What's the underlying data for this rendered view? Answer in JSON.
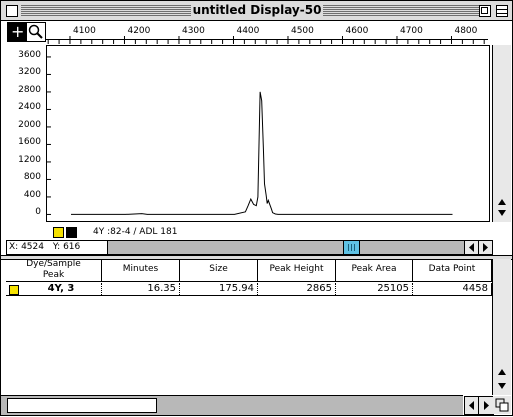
{
  "window": {
    "title": "untitled Display-50"
  },
  "ruler": {
    "ticks": [
      "4100",
      "4200",
      "4300",
      "4400",
      "4500",
      "4600",
      "4700",
      "4800"
    ]
  },
  "plot": {
    "y_ticks": [
      "3600",
      "3200",
      "2800",
      "2400",
      "2000",
      "1600",
      "1200",
      "800",
      "400",
      "0"
    ],
    "sample_label": "4Y :82-4 / ADL 181",
    "colors": {
      "yellow": "#f5e100",
      "black": "#000000"
    }
  },
  "chart_data": {
    "type": "line",
    "x": [
      4100,
      4200,
      4230,
      4240,
      4300,
      4400,
      4420,
      4425,
      4430,
      4435,
      4440,
      4443,
      4447,
      4450,
      4453,
      4455,
      4458,
      4460,
      4462,
      4465,
      4468,
      4470,
      4475,
      4480,
      4500,
      4600,
      4700,
      4800
    ],
    "series": [
      {
        "values": [
          0,
          0,
          20,
          0,
          0,
          0,
          60,
          200,
          350,
          230,
          200,
          400,
          2800,
          2600,
          1500,
          700,
          450,
          250,
          320,
          220,
          120,
          40,
          10,
          0,
          0,
          0,
          0,
          0
        ]
      }
    ],
    "xlim": [
      4056,
      4867
    ],
    "ylim": [
      -150,
      3850
    ],
    "grid": false
  },
  "status": {
    "x_label": "X:",
    "x_value": "4524",
    "y_label": "Y:",
    "y_value": "616"
  },
  "table": {
    "headers": [
      "Dye/Sample\nPeak",
      "Minutes",
      "Size",
      "Peak Height",
      "Peak Area",
      "Data Point"
    ],
    "rows": [
      {
        "dye_sample_peak": "4Y, 3",
        "minutes": "16.35",
        "size": "175.94",
        "peak_height": "2865",
        "peak_area": "25105",
        "data_point": "4458"
      }
    ]
  }
}
